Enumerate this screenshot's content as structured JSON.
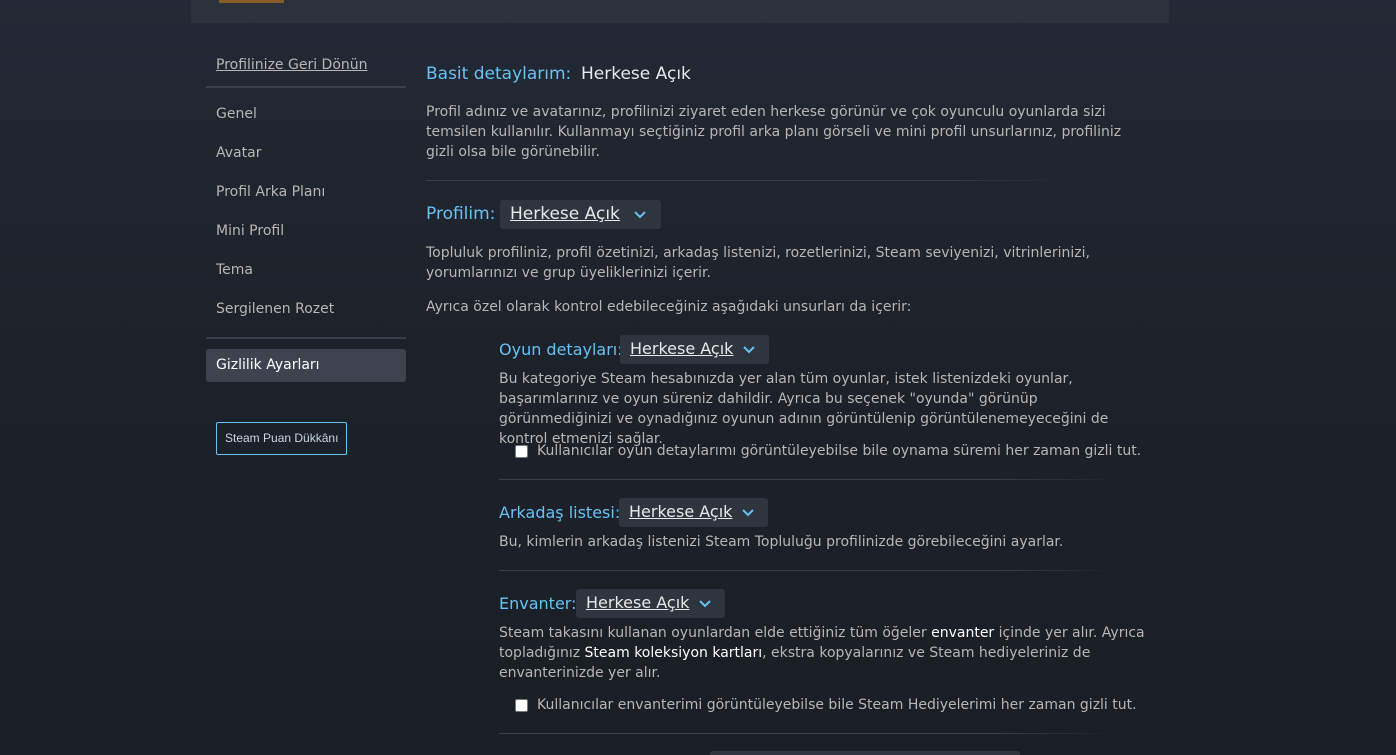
{
  "sidebar": {
    "back_link": "Profilinize Geri Dönün",
    "items": [
      "Genel",
      "Avatar",
      "Profil Arka Planı",
      "Mini Profil",
      "Tema",
      "Sergilenen Rozet"
    ],
    "active_item": "Gizlilik Ayarları",
    "points_shop_button": "Steam Puan Dükkânı"
  },
  "basic": {
    "label": "Basit detaylarım:",
    "value": "Herkese Açık",
    "description": "Profil adınız ve avatarınız, profilinizi ziyaret eden herkese görünür ve çok oyunculu oyunlarda sizi temsilen kullanılır. Kullanmayı seçtiğiniz profil arka planı görseli ve mini profil unsurlarınız, profiliniz gizli olsa bile görünebilir."
  },
  "profile": {
    "label": "Profilim:",
    "value": "Herkese Açık",
    "description": "Topluluk profiliniz, profil özetinizi, arkadaş listenizi, rozetlerinizi, Steam seviyenizi, vitrinlerinizi, yorumlarınızı ve grup üyeliklerinizi içerir.",
    "also_includes": "Ayrıca özel olarak kontrol edebileceğiniz aşağıdaki unsurları da içerir:"
  },
  "game_details": {
    "label": "Oyun detayları:",
    "value": "Herkese Açık",
    "description": "Bu kategoriye Steam hesabınızda yer alan tüm oyunlar, istek listenizdeki oyunlar, başarımlarınız ve oyun süreniz dahildir. Ayrıca bu seçenek \"oyunda\" görünüp görünmediğinizi ve oynadığınız oyunun adının görüntülenip görüntülenemeyeceğini de kontrol etmenizi sağlar.",
    "checkbox_label": "Kullanıcılar oyun detaylarımı görüntüleyebilse bile oynama süremi her zaman gizli tut."
  },
  "friends": {
    "label": "Arkadaş listesi:",
    "value": "Herkese Açık",
    "description": "Bu, kimlerin arkadaş listenizi Steam Topluluğu profilinizde görebileceğini ayarlar."
  },
  "inventory": {
    "label": "Envanter:",
    "value": "Herkese Açık",
    "desc_part1": "Steam takasını kullanan oyunlardan elde ettiğiniz tüm öğeler ",
    "desc_hl1": "envanter",
    "desc_part2": " içinde yer alır. Ayrıca topladığınız ",
    "desc_hl2": "Steam koleksiyon kartları",
    "desc_part3": ", ekstra kopyalarınız ve Steam hediyeleriniz de envanterinizde yer alır.",
    "checkbox_label": "Kullanıcılar envanterimi görüntüleyebilse bile Steam Hediyelerimi her zaman gizli tut."
  },
  "colors": {
    "accent": "#67c1f5",
    "background": "#1b2028",
    "text": "#b8b6b4"
  }
}
